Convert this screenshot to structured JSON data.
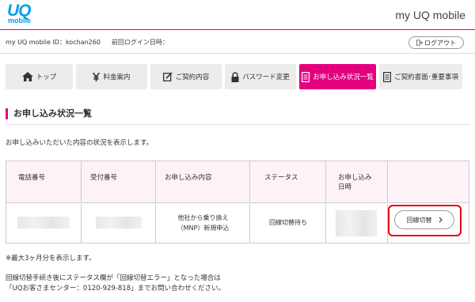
{
  "header": {
    "logo_text": "UQ",
    "logo_subtext": "mobile",
    "title": "my UQ mobile"
  },
  "subheader": {
    "user_id": "my UQ mobile ID：kochan260",
    "last_login": "前回ログイン日時：",
    "logout_label": "ログアウト"
  },
  "nav": {
    "tabs": [
      {
        "label": "トップ",
        "icon": "home-icon"
      },
      {
        "label": "料金案内",
        "icon": "yen-icon"
      },
      {
        "label": "ご契約内容",
        "icon": "edit-icon"
      },
      {
        "label": "パスワード変更",
        "icon": "lock-icon"
      },
      {
        "label": "お申し込み状況一覧",
        "icon": "document-icon",
        "active": true
      },
      {
        "label": "ご契約書面･重要事項",
        "icon": "document-icon"
      }
    ]
  },
  "main": {
    "section_title": "お申し込み状況一覧",
    "description": "お申し込みいただいた内容の状況を表示します。",
    "table": {
      "headers": [
        "電話番号",
        "受付番号",
        "お申し込み内容",
        "ステータス",
        "お申し込み",
        "日時"
      ],
      "row": {
        "content_line1": "他社から乗り換え",
        "content_line2": "（MNP）新規申込",
        "status": "回線切替待ち",
        "action_label": "回線切替"
      }
    },
    "notes": {
      "line1": "※最大3ヶ月分を表示します。",
      "line2": "回線切替手続き後にステータス欄が「回線切替エラー」となった場合は",
      "line3": "「UQお客さまセンター：0120-929-818」までお問い合わせください。"
    }
  },
  "colors": {
    "accent": "#e4007f",
    "brand": "#00a0e9",
    "highlight": "#e60012"
  }
}
